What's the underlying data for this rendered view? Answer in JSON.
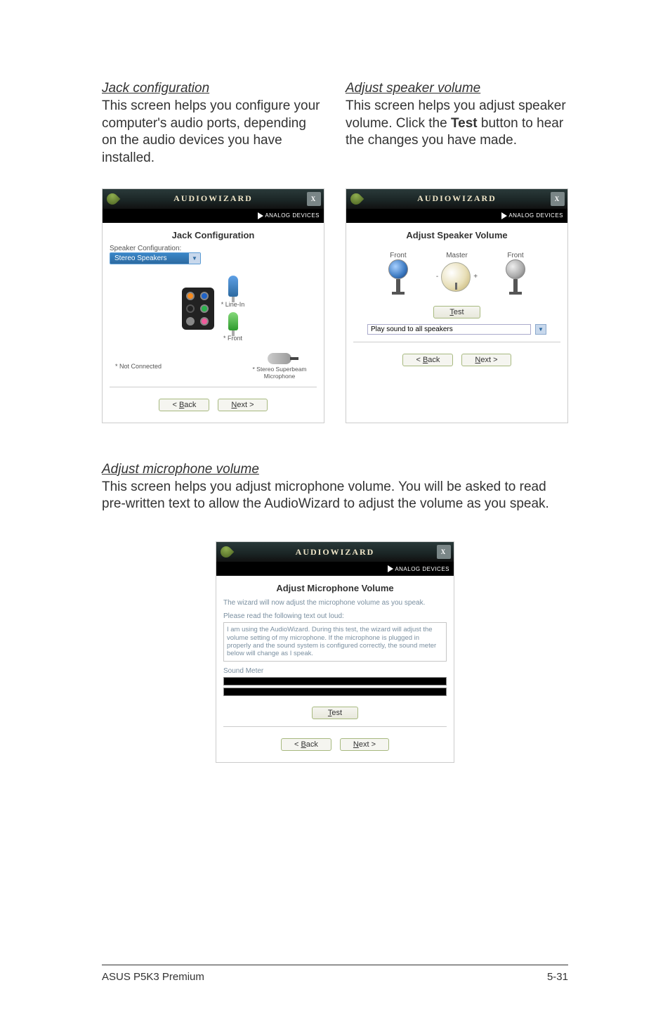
{
  "section1": {
    "left": {
      "heading": "Jack configuration",
      "text": "This screen helps you configure your computer's audio ports, depending on the audio devices you have installed."
    },
    "right": {
      "heading": "Adjust speaker volume",
      "text_pre": "This screen helps you adjust speaker volume. Click the ",
      "text_bold": "Test",
      "text_post": " button to hear the changes you have made."
    }
  },
  "wizard_common": {
    "title": "AUDIOWIZARD",
    "brand": "ANALOG DEVICES",
    "back": "Back",
    "next": "Next >",
    "close": "X"
  },
  "jack_panel": {
    "heading": "Jack Configuration",
    "spk_config_label": "Speaker Configuration:",
    "spk_config_value": "Stereo Speakers",
    "line_in": "* Line-In",
    "front": "* Front",
    "not_connected": "* Not Connected",
    "mic_label": "* Stereo Superbeam Microphone"
  },
  "speaker_panel": {
    "heading": "Adjust Speaker Volume",
    "front_l": "Front",
    "front_r": "Front",
    "master": "Master",
    "test": "Test",
    "dropdown": "Play sound to all speakers"
  },
  "mic_section": {
    "heading": "Adjust microphone volume",
    "text": "This screen helps you adjust microphone volume. You will be asked to read pre-written text to allow the AudioWizard to adjust the volume as you speak."
  },
  "mic_panel": {
    "heading": "Adjust Microphone Volume",
    "desc": "The wizard will now adjust the microphone volume as you speak.",
    "read_label": "Please read the following text out loud:",
    "read_text": "I am using the AudioWizard. During this test, the wizard will adjust the volume setting of my microphone. If the microphone is plugged in properly and the sound system is configured correctly, the sound meter below will change as I speak.",
    "sound_meter": "Sound Meter",
    "test": "Test"
  },
  "footer": {
    "left": "ASUS P5K3 Premium",
    "right": "5-31"
  }
}
